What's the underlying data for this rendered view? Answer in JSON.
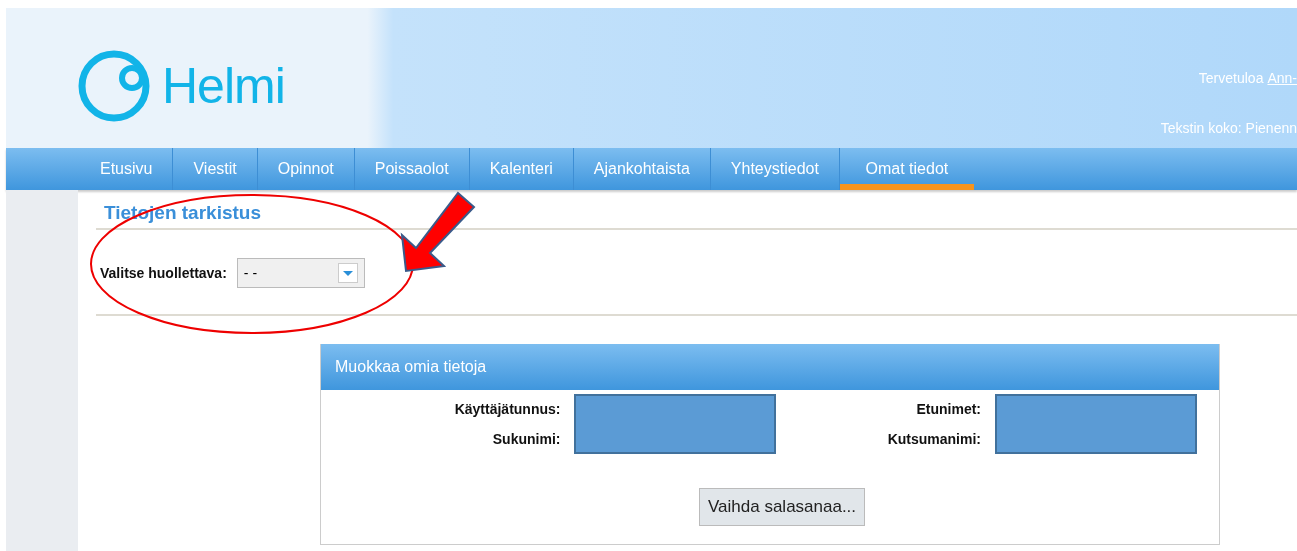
{
  "header": {
    "logo_text": "Helmi",
    "welcome": "Tervetuloa",
    "user_link": "Ann-",
    "text_size": "Tekstin koko: Pienenn"
  },
  "nav": [
    {
      "label": "Etusivu",
      "selected": false
    },
    {
      "label": "Viestit",
      "selected": false
    },
    {
      "label": "Opinnot",
      "selected": false
    },
    {
      "label": "Poissaolot",
      "selected": false
    },
    {
      "label": "Kalenteri",
      "selected": false
    },
    {
      "label": "Ajankohtaista",
      "selected": false
    },
    {
      "label": "Yhteystiedot",
      "selected": false
    },
    {
      "label": "Omat tiedot",
      "selected": true
    }
  ],
  "section": {
    "title": "Tietojen tarkistus",
    "select_label": "Valitse huollettava:",
    "select_value": "- -"
  },
  "panel": {
    "title": "Muokkaa omia tietoja",
    "columns": [
      {
        "labels": [
          "Käyttäjätunnus:",
          "Sukunimi:"
        ]
      },
      {
        "labels": [
          "Etunimet:",
          "Kutsumanimi:"
        ]
      }
    ],
    "button": "Vaihda salasanaa..."
  }
}
